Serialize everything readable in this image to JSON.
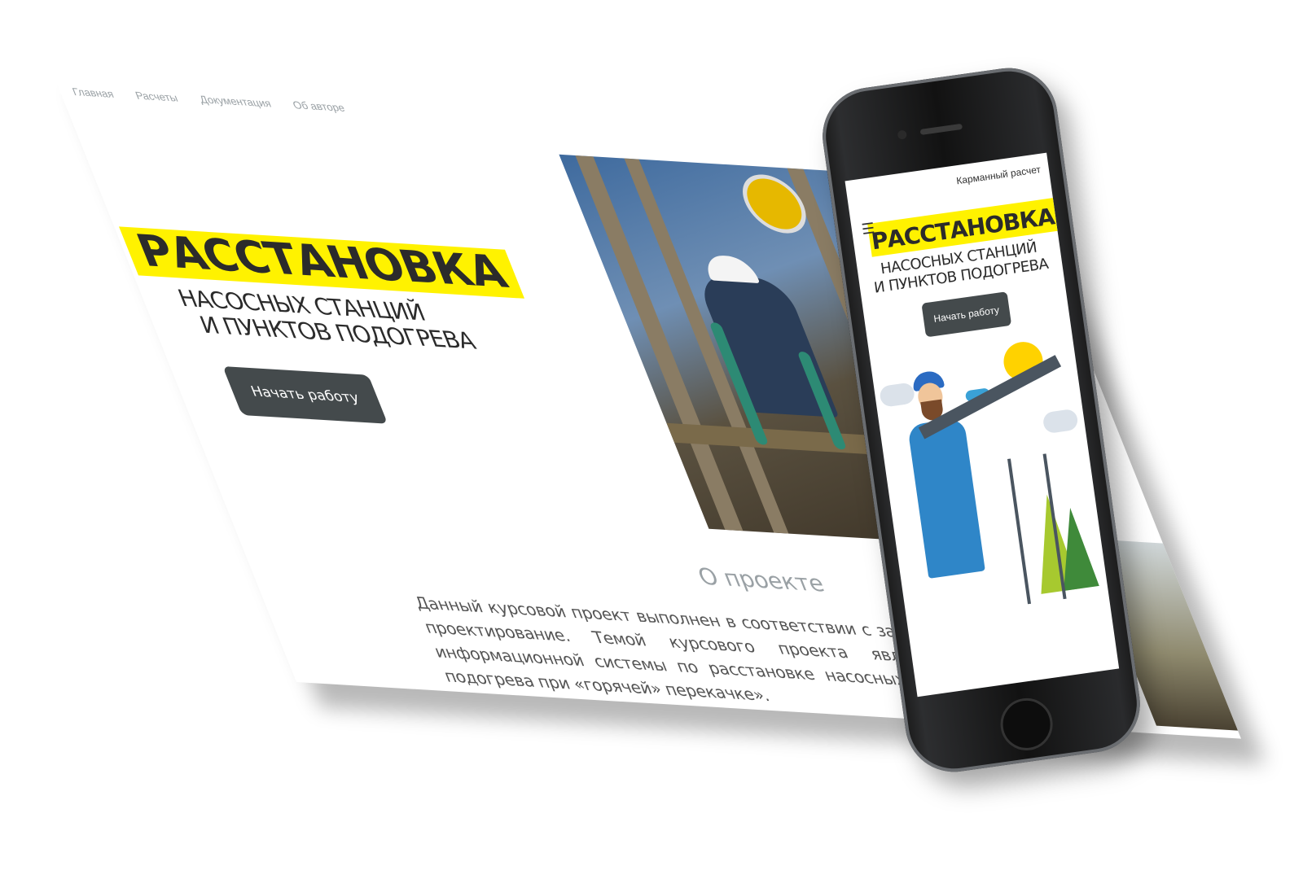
{
  "desktop": {
    "nav": [
      "Главная",
      "Расчеты",
      "Документация",
      "Об авторе"
    ],
    "hero": {
      "title": "РАССТАНОВКА",
      "subtitle_line1": "НАСОСНЫХ СТАНЦИЙ",
      "subtitle_line2": "И ПУНКТОВ ПОДОГРЕВА",
      "button": "Начать работу"
    },
    "about": {
      "title": "О проекте",
      "text": "Данный курсовой проект выполнен в соответствии с заданием на курсовое проектирование. Темой курсового проекта является «Разработка информационной системы по расстановке насосных станций и пунктов подогрева при «горячей» перекачке»."
    }
  },
  "mobile": {
    "brand": "Карманный расчет",
    "menu_icon": "☰",
    "hero": {
      "title": "РАССТАНОВКА",
      "subtitle_line1": "НАСОСНЫХ СТАНЦИЙ",
      "subtitle_line2": "И ПУНКТОВ ПОДОГРЕВА",
      "button": "Начать работу"
    }
  },
  "colors": {
    "accent": "#fff200",
    "button": "#444a4c",
    "text_dark": "#2b2b2b",
    "text_muted": "#9aa1a5"
  },
  "icons": [
    "user-icon",
    "hamburger-menu-icon"
  ]
}
